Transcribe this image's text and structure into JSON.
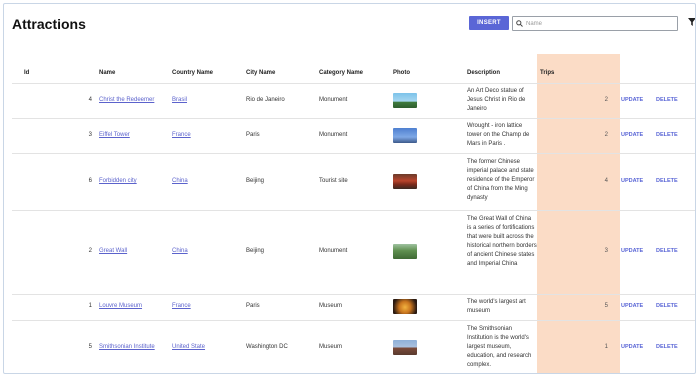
{
  "page": {
    "title": "Attractions"
  },
  "toolbar": {
    "insert_label": "INSERT",
    "search_placeholder": "Name"
  },
  "columns": [
    "Id",
    "Name",
    "Country Name",
    "City Name",
    "Category Name",
    "Photo",
    "Description",
    "Trips"
  ],
  "rows": [
    {
      "id": "4",
      "name": "Christ the Redeemer",
      "country": "Brasil",
      "city": "Rio de Janeiro",
      "category": "Monument",
      "photo": "christ-the-redeemer-photo",
      "description": "An Art Deco statue of Jesus Christ in Rio de Janeiro",
      "trips": "2",
      "update": "UPDATE",
      "delete": "DELETE"
    },
    {
      "id": "3",
      "name": "Eiffel Tower",
      "country": "France",
      "city": "Paris",
      "category": "Monument",
      "photo": "eiffel-tower-photo",
      "description": "Wrought - iron lattice tower on the Champ de Mars in Paris .",
      "trips": "2",
      "update": "UPDATE",
      "delete": "DELETE"
    },
    {
      "id": "6",
      "name": "Forbidden city",
      "country": "China",
      "city": "Beijing",
      "category": "Tourist site",
      "photo": "forbidden-city-photo",
      "description": "The former Chinese imperial palace and state residence of the Emperor of China from the Ming dynasty",
      "trips": "4",
      "update": "UPDATE",
      "delete": "DELETE"
    },
    {
      "id": "2",
      "name": "Great Wall",
      "country": "China",
      "city": "Beijing",
      "category": "Monument",
      "photo": "great-wall-photo",
      "description": "The Great Wall of China is a series of fortifications that were built across the historical northern borders of ancient Chinese states and Imperial China",
      "trips": "3",
      "update": "UPDATE",
      "delete": "DELETE"
    },
    {
      "id": "1",
      "name": "Louvre Museum",
      "country": "France",
      "city": "Paris",
      "category": "Museum",
      "photo": "louvre-museum-photo",
      "description": "The world's largest art museum",
      "trips": "5",
      "update": "UPDATE",
      "delete": "DELETE"
    },
    {
      "id": "5",
      "name": "Smithsonian Institute",
      "country": "United State",
      "city": "Washington DC",
      "category": "Museum",
      "photo": "smithsonian-institute-photo",
      "description": "The Smithsonian Institution is the world's largest museum, education, and research complex.",
      "trips": "1",
      "update": "UPDATE",
      "delete": "DELETE"
    }
  ],
  "colors": {
    "accent": "#5a66d6",
    "trips_highlight": "#fbdcc6",
    "link": "#5b62cc"
  }
}
